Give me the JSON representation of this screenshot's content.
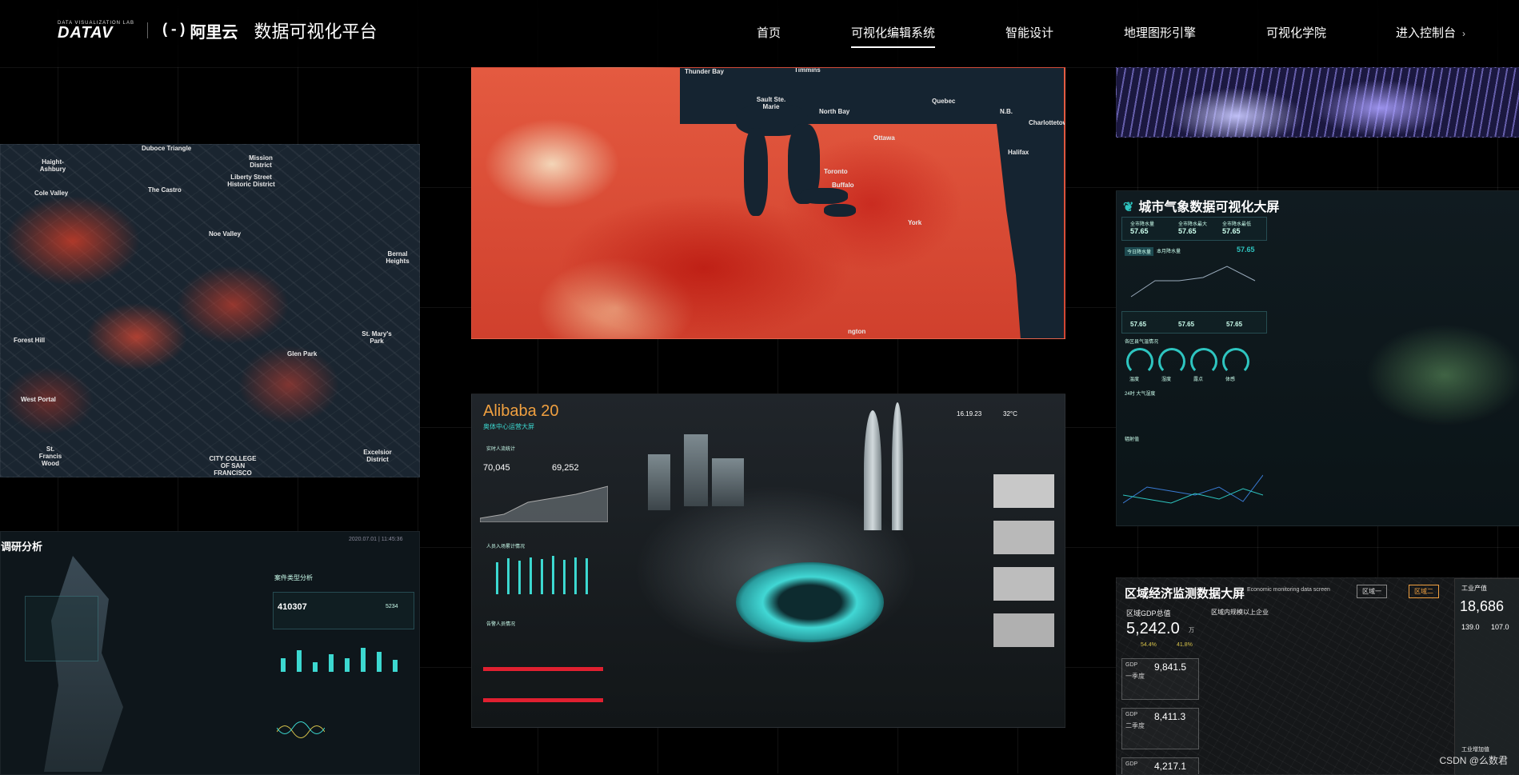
{
  "header": {
    "datav_small": "DATA VISUALIZATION LAB",
    "datav_logo": "DATAV",
    "aliyun_mark": "(-)",
    "aliyun_name": "阿里云",
    "platform_title": "数据可视化平台"
  },
  "nav": {
    "items": [
      {
        "label": "首页",
        "active": false
      },
      {
        "label": "可视化编辑系统",
        "active": true
      },
      {
        "label": "智能设计",
        "active": false
      },
      {
        "label": "地理图形引擎",
        "active": false
      },
      {
        "label": "可视化学院",
        "active": false
      },
      {
        "label": "进入控制台",
        "active": false
      }
    ],
    "console_chevron": "chevron-right-icon"
  },
  "topo_map": {
    "labels": [
      "Duboce Triangle",
      "Haight-Ashbury",
      "Mission District",
      "Liberty Street Historic District",
      "Cole Valley",
      "The Castro",
      "Noe Valley",
      "Bernal Heights",
      "Forest Hill",
      "Glen Park",
      "St. Mary's Park",
      "West Portal",
      "St. Francis Wood",
      "Excelsior District",
      "CITY COLLEGE OF SAN FRANCISCO"
    ]
  },
  "us_map": {
    "labels": [
      "Thunder Bay",
      "Timmins",
      "Sault Ste. Marie",
      "North Bay",
      "Quebec",
      "Ottawa",
      "Charlottetown",
      "Halifax",
      "Toronto",
      "York",
      "Buffalo",
      "ngton",
      "N.B."
    ]
  },
  "weather_dash": {
    "title": "城市气象数据可视化大屏",
    "stats": [
      "57.65",
      "57.65",
      "57.65",
      "57.65",
      "57.65",
      "57.65"
    ],
    "stat_labels": [
      "全市降水量",
      "全市降水最大",
      "全市降水最低"
    ],
    "tabs": [
      "今日降水量",
      "本月降水量"
    ],
    "big_value": "57.65",
    "section1": "各区县气温情况",
    "section2": "24时 大气湿度",
    "section3": "辐射值",
    "gauge_labels": [
      "温度",
      "湿度",
      "露点",
      "体感"
    ]
  },
  "alibaba_dash": {
    "title": "Alibaba 20",
    "subtitle": "奥体中心运营大屏",
    "time": "16.19.23",
    "temp": "32°C",
    "value1": "70,045",
    "value2": "69,252",
    "section1": "实时人流统计",
    "section2": "人员入场累计情况",
    "section3": "告警人员情况"
  },
  "research_dash": {
    "title": "调研分析",
    "date": "2020.07.01 | 11:45:36",
    "section": "案件类型分析",
    "value": "410307",
    "stat1": "5234",
    "bars": [
      0.35,
      0.55,
      0.25,
      0.45,
      0.35,
      0.6,
      0.5,
      0.3
    ]
  },
  "econ_dash": {
    "title": "区域经济监测数据大屏",
    "subtitle": "Economic monitoring data screen",
    "btn1": "区域一",
    "btn2": "区域二",
    "gdp_title": "区域GDP总值",
    "gdp_total": "5,242.0",
    "gdp_unit": "万",
    "growth1": "54.4%",
    "growth2": "41.8%",
    "q1_label": "一季度",
    "q1_value": "9,841.5",
    "q2_label": "二季度",
    "q2_value": "8,411.3",
    "q3_value": "4,217.1",
    "gdp_tag": "GDP",
    "map_title": "区域内规模以上企业",
    "right_title": "工业产值",
    "right_value": "18,686",
    "right_sub1": "139.0",
    "right_sub2": "107.0",
    "right_footer": "工业增加值"
  },
  "watermark": "CSDN @么数君"
}
